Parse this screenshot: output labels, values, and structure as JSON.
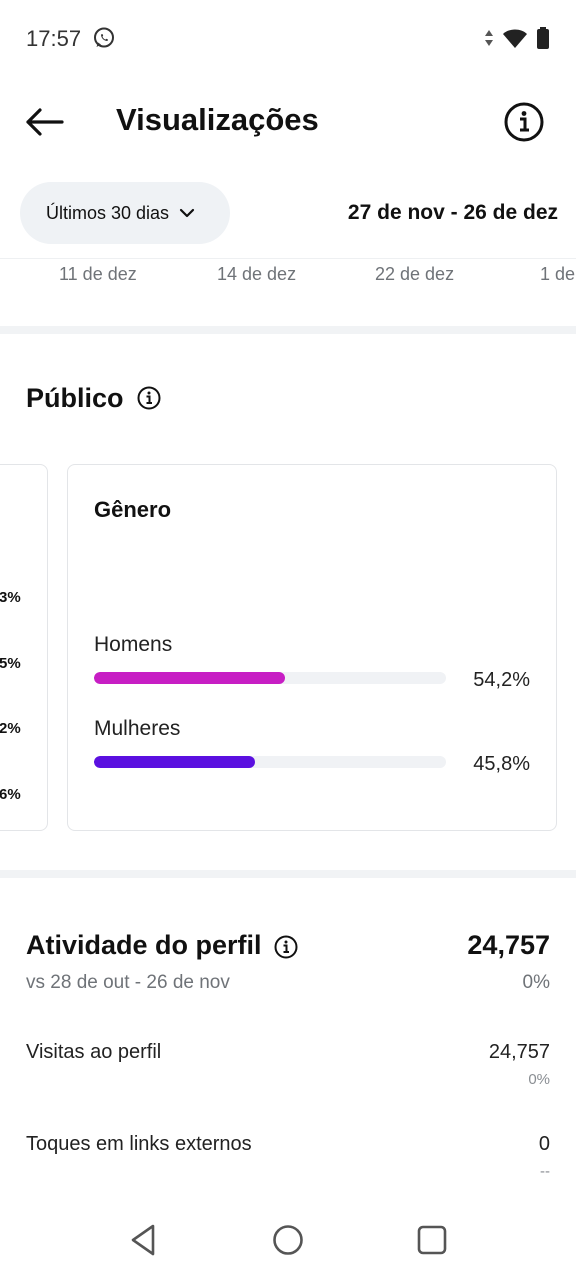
{
  "status_bar": {
    "time": "17:57"
  },
  "header": {
    "title": "Visualizações"
  },
  "range": {
    "selector_label": "Últimos 30 dias",
    "dates": "27 de nov - 26 de dez"
  },
  "chart_ticks": [
    "11 de dez",
    "14 de dez",
    "22 de dez",
    "1 de"
  ],
  "audience": {
    "title": "Público",
    "left_card_values": [
      "3%",
      "5%",
      "2%",
      "6%"
    ],
    "gender": {
      "title": "Gênero",
      "items": [
        {
          "label": "Homens",
          "percent_text": "54,2%",
          "fraction": 0.542,
          "color": "#c71ec4"
        },
        {
          "label": "Mulheres",
          "percent_text": "45,8%",
          "fraction": 0.458,
          "color": "#5b10e0"
        }
      ]
    }
  },
  "profile_activity": {
    "title": "Atividade do perfil",
    "compare": "vs 28 de out - 26 de nov",
    "value": "24,757",
    "delta": "0%",
    "rows": [
      {
        "label": "Visitas ao perfil",
        "value": "24,757",
        "delta": "0%"
      },
      {
        "label": "Toques em links externos",
        "value": "0",
        "delta": "--"
      }
    ]
  }
}
